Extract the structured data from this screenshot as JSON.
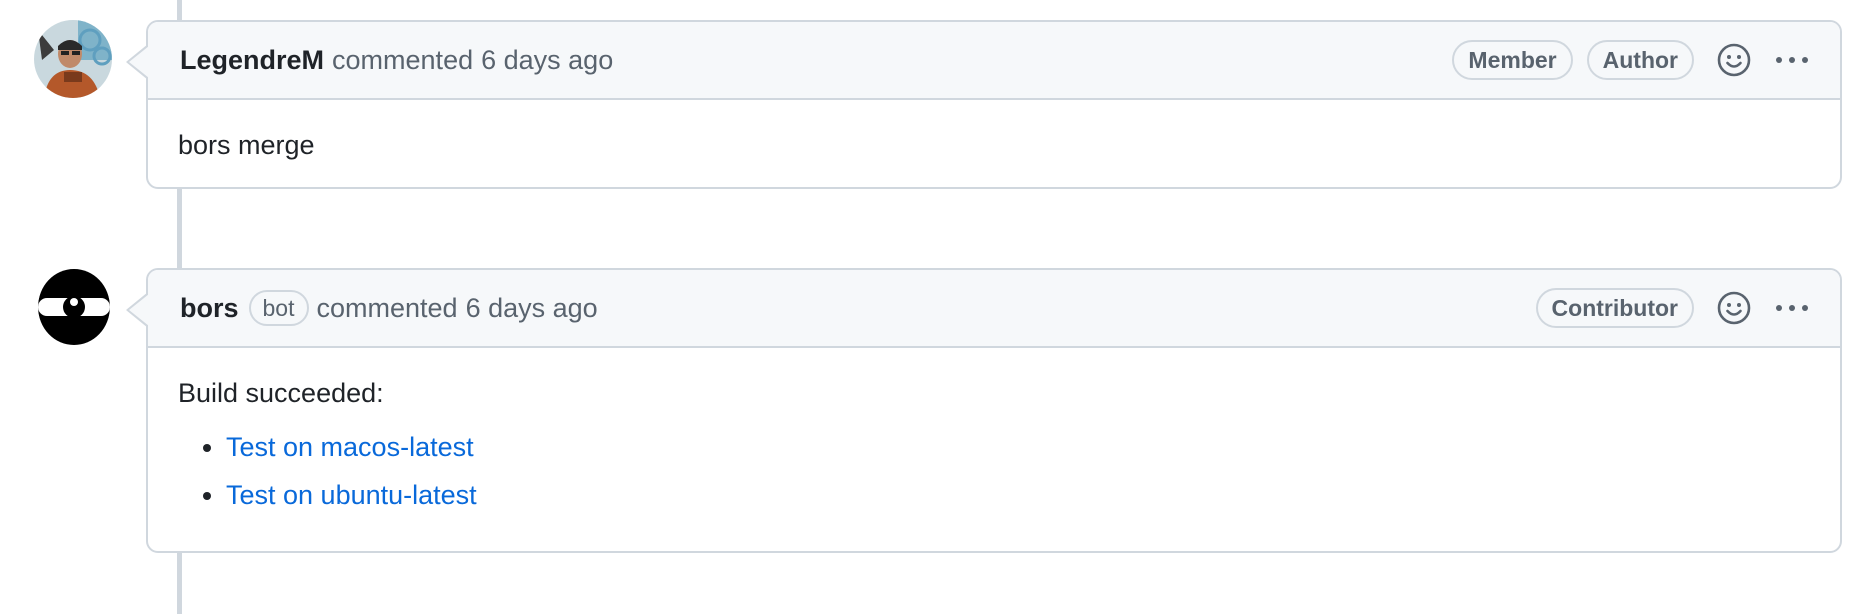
{
  "comments": [
    {
      "author": "LegendreM",
      "action": "commented",
      "time": "6 days ago",
      "roles": [
        "Member",
        "Author"
      ],
      "body": "bors merge"
    },
    {
      "author": "bors",
      "bot_label": "bot",
      "action": "commented",
      "time": "6 days ago",
      "roles": [
        "Contributor"
      ],
      "body_intro": "Build succeeded:",
      "links": [
        "Test on macos-latest",
        "Test on ubuntu-latest"
      ]
    }
  ],
  "colors": {
    "link": "#0969da",
    "border": "#d0d7de",
    "header_bg": "#f6f8fa",
    "muted": "#59636e"
  },
  "icons": [
    "smiley-icon",
    "kebab-horizontal-icon"
  ]
}
